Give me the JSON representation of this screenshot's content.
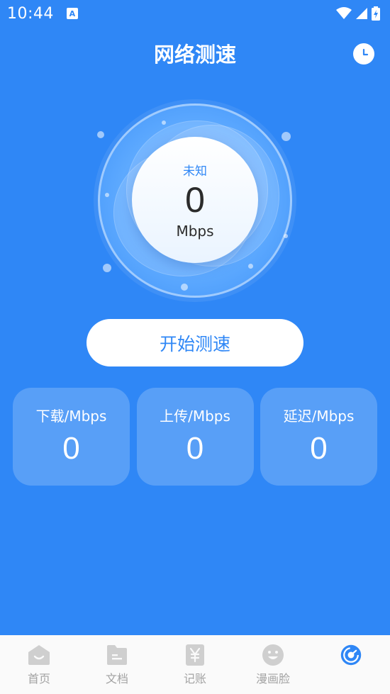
{
  "status_bar": {
    "time": "10:44",
    "notification_icon": "a-icon",
    "icons": [
      "wifi-icon",
      "signal-icon",
      "battery-charging-icon"
    ]
  },
  "header": {
    "title": "网络测速",
    "history_icon": "clock-icon"
  },
  "gauge": {
    "status": "未知",
    "value": "0",
    "unit": "Mbps"
  },
  "start_button": {
    "label": "开始测速"
  },
  "stats": [
    {
      "label": "下载/Mbps",
      "value": "0"
    },
    {
      "label": "上传/Mbps",
      "value": "0"
    },
    {
      "label": "延迟/Mbps",
      "value": "0"
    }
  ],
  "tab_bar": {
    "items": [
      {
        "label": "首页",
        "icon": "home-icon"
      },
      {
        "label": "文档",
        "icon": "document-icon"
      },
      {
        "label": "记账",
        "icon": "yen-icon"
      },
      {
        "label": "漫画脸",
        "icon": "smiley-icon"
      },
      {
        "label": "",
        "icon": "speed-test-icon",
        "active": true
      }
    ]
  },
  "colors": {
    "background": "#2f87f6",
    "accent": "#2f87f6",
    "tab_inactive": "#a3a3a3",
    "tab_active": "#2f87f6"
  }
}
